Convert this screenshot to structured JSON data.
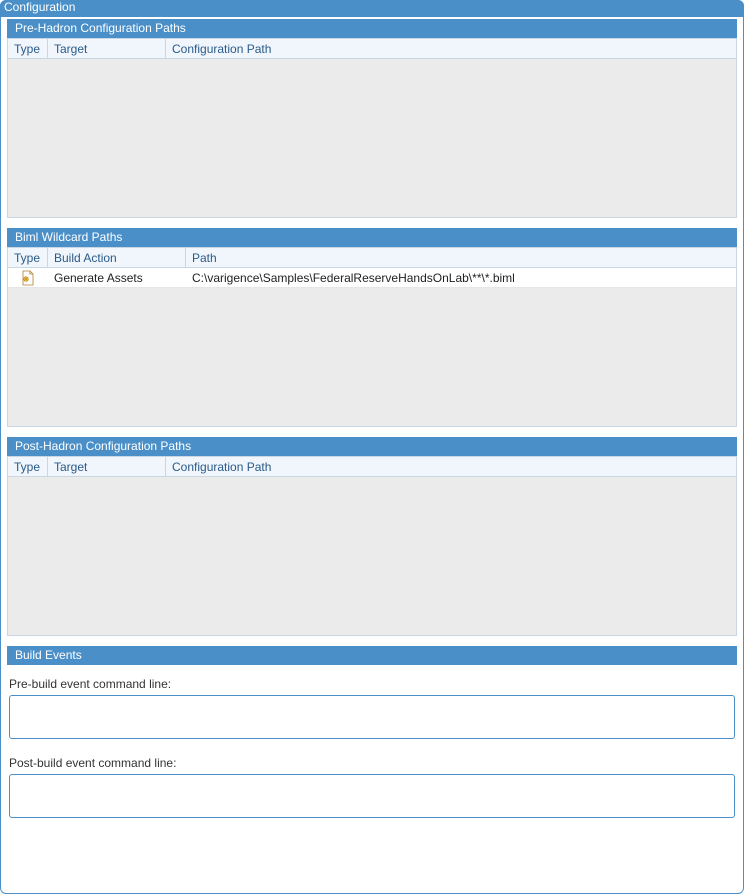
{
  "window": {
    "title": "Configuration"
  },
  "sections": {
    "preHadron": {
      "title": "Pre-Hadron Configuration Paths",
      "columns": {
        "type": "Type",
        "target": "Target",
        "confpath": "Configuration Path"
      },
      "rows": []
    },
    "bimlWildcard": {
      "title": "Biml Wildcard Paths",
      "columns": {
        "type": "Type",
        "build": "Build Action",
        "path": "Path"
      },
      "rows": [
        {
          "icon": "biml-file-icon",
          "build": "Generate Assets",
          "path": "C:\\varigence\\Samples\\FederalReserveHandsOnLab\\**\\*.biml"
        }
      ]
    },
    "postHadron": {
      "title": "Post-Hadron Configuration Paths",
      "columns": {
        "type": "Type",
        "target": "Target",
        "confpath": "Configuration Path"
      },
      "rows": []
    },
    "buildEvents": {
      "title": "Build Events",
      "preLabel": "Pre-build event command line:",
      "preValue": "",
      "postLabel": "Post-build event command line:",
      "postValue": ""
    }
  }
}
